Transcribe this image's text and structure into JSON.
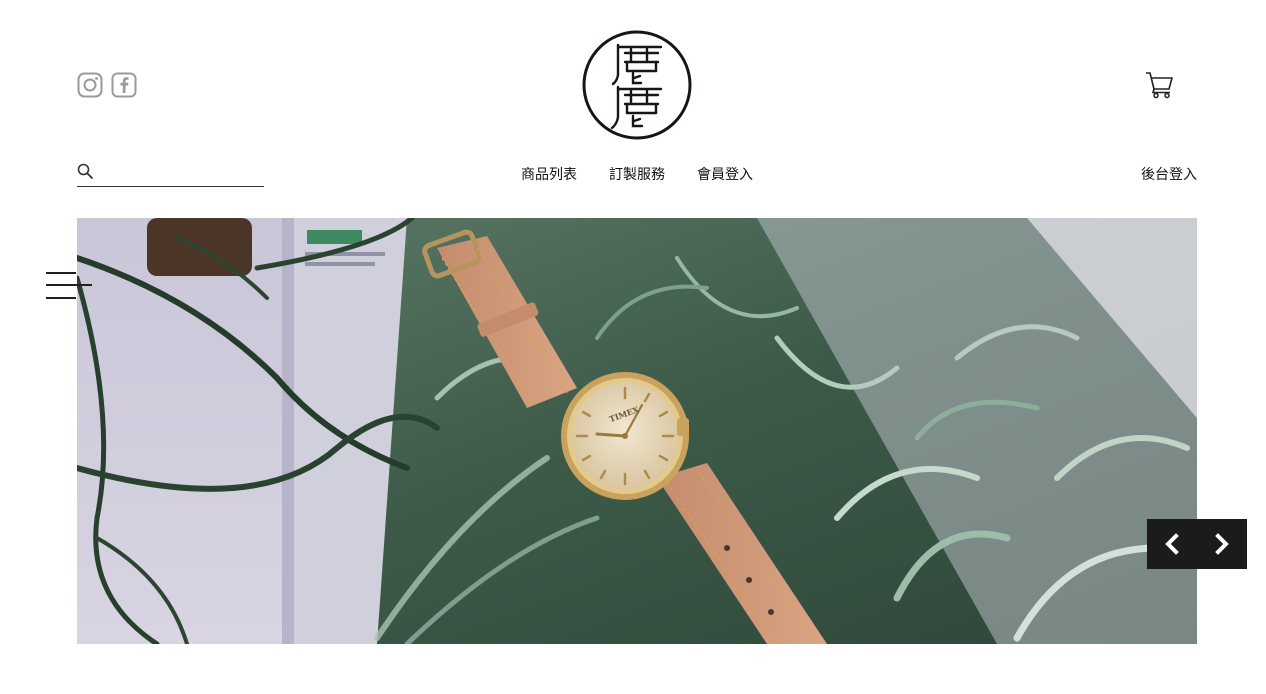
{
  "header": {
    "social": [
      {
        "icon": "instagram-icon"
      },
      {
        "icon": "facebook-icon"
      }
    ],
    "logo": {
      "alt": "鹿鹿"
    },
    "cart": {
      "icon": "cart-icon"
    }
  },
  "search": {
    "icon": "search-icon",
    "placeholder": "",
    "value": ""
  },
  "nav": {
    "items": [
      {
        "label": "商品列表"
      },
      {
        "label": "訂製服務"
      },
      {
        "label": "會員登入"
      }
    ],
    "admin_label": "後台登入"
  },
  "hero": {
    "image": "watch on leather strap lying on air plants",
    "watch_brand": "TIMEX"
  },
  "slider": {
    "prev_icon": "chevron-left-icon",
    "next_icon": "chevron-right-icon"
  },
  "menu": {
    "icon": "hamburger-menu-icon"
  },
  "colors": {
    "text": "#111111",
    "icon_gray": "#9a9a9a",
    "control_bg": "#1b1b1b"
  }
}
